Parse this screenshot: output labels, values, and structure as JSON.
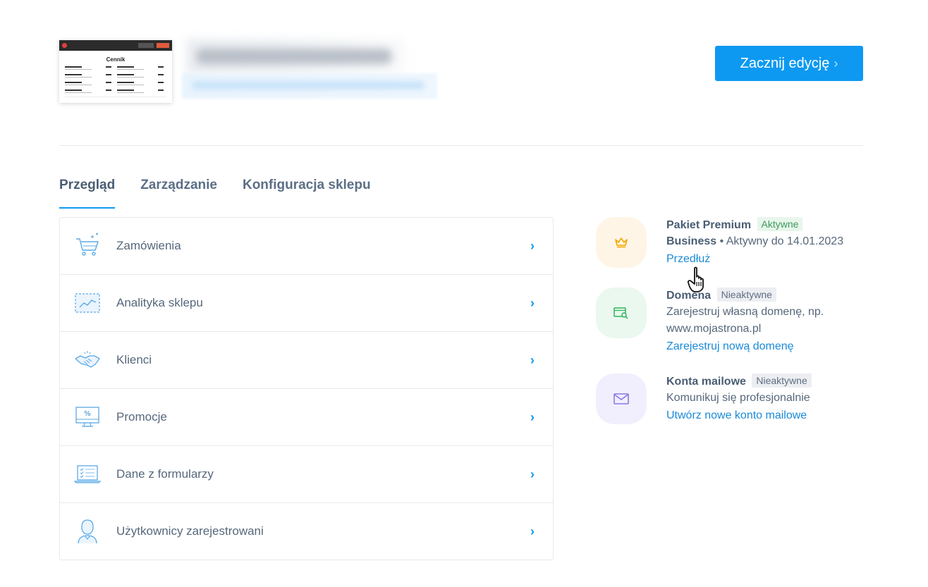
{
  "thumbnail": {
    "title": "Cennik"
  },
  "header": {
    "start_button": "Zacznij edycję"
  },
  "tabs": [
    {
      "label": "Przegląd",
      "active": true
    },
    {
      "label": "Zarządzanie",
      "active": false
    },
    {
      "label": "Konfiguracja sklepu",
      "active": false
    }
  ],
  "menu": [
    {
      "label": "Zamówienia",
      "icon": "cart-icon"
    },
    {
      "label": "Analityka sklepu",
      "icon": "analytics-chart-icon"
    },
    {
      "label": "Klienci",
      "icon": "handshake-icon"
    },
    {
      "label": "Promocje",
      "icon": "percent-monitor-icon"
    },
    {
      "label": "Dane z formularzy",
      "icon": "form-laptop-icon"
    },
    {
      "label": "Użytkownicy zarejestrowani",
      "icon": "user-icon"
    }
  ],
  "features": {
    "premium": {
      "title": "Pakiet Premium",
      "badge": "Aktywne",
      "plan": "Business",
      "status": "• Aktywny do 14.01.2023",
      "link": "Przedłuż"
    },
    "domain": {
      "title": "Domena",
      "badge": "Nieaktywne",
      "desc1": "Zarejestruj własną domenę, np.",
      "desc2": "www.mojastrona.pl",
      "link": "Zarejestruj nową domenę"
    },
    "mail": {
      "title": "Konta mailowe",
      "badge": "Nieaktywne",
      "desc": "Komunikuj się profesjonalnie",
      "link": "Utwórz nowe konto mailowe"
    }
  },
  "colors": {
    "accent": "#0d99f2",
    "premium_bg": "#fff5e6",
    "domain_bg": "#eaf8ef",
    "mail_bg": "#f1effd"
  }
}
